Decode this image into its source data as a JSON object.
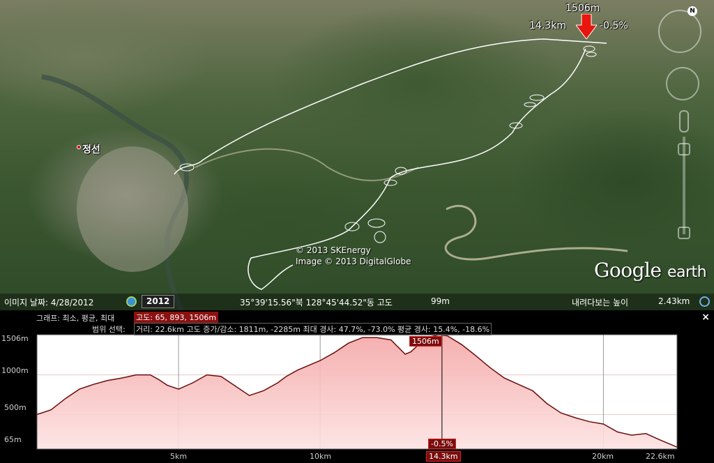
{
  "map": {
    "place_name": "정선",
    "copyright_1": "© 2013 SKEnergy",
    "copyright_2": "Image © 2013 DigitalGlobe",
    "brand_google": "Google",
    "brand_earth": "earth",
    "compass_letter": "N",
    "callout": {
      "elevation": "1506m",
      "distance": "14.3km",
      "slope": "-0.5%"
    }
  },
  "statusbar": {
    "image_date": "이미지 날짜: 4/28/2012",
    "year": "2012",
    "coords": "35°39'15.56\"북 128°45'44.52\"동 고도",
    "altitude": "99m",
    "eye_alt_label": "내려다보는 높이",
    "eye_alt": "2.43km"
  },
  "profile": {
    "graph_label": "그래프: 최소, 평균, 최대",
    "graph_value": "고도: 65, 893, 1506m",
    "stats_label": "범위 선택:",
    "stats_value": "거리: 22.6km 고도 증가/감소: 1811m, -2285m 최대 경사: 47.7%, -73.0% 평균 경사: 15.4%, -18.6%",
    "close": "×",
    "y_ticks": [
      "1506m",
      "1000m",
      "500m",
      "65m"
    ],
    "x_ticks": [
      "5km",
      "10km",
      "20km",
      "22.6km"
    ],
    "cursor_elev": "1506m",
    "cursor_slope": "-0.5%",
    "cursor_dist": "14.3km"
  },
  "chart_data": {
    "type": "area",
    "x_unit": "km",
    "y_unit": "m",
    "xlim": [
      0,
      22.6
    ],
    "ylim": [
      65,
      1506
    ],
    "cursor_x": 14.3,
    "x": [
      0,
      0.5,
      1,
      1.5,
      2,
      2.5,
      3,
      3.5,
      4,
      4.3,
      4.6,
      5,
      5.5,
      6,
      6.5,
      7,
      7.5,
      8,
      8.5,
      8.8,
      9.2,
      9.6,
      10,
      10.5,
      11,
      11.5,
      12,
      12.5,
      13,
      13.2,
      13.5,
      13.8,
      14.2,
      14.5,
      15,
      15.5,
      16,
      16.5,
      17,
      17.5,
      18,
      18.5,
      19,
      19.5,
      20,
      20.5,
      21,
      21.5,
      22,
      22.6
    ],
    "y": [
      500,
      560,
      700,
      820,
      880,
      930,
      960,
      1000,
      1000,
      940,
      870,
      820,
      900,
      1000,
      980,
      860,
      740,
      800,
      900,
      980,
      1060,
      1120,
      1180,
      1280,
      1400,
      1470,
      1470,
      1440,
      1260,
      1290,
      1390,
      1470,
      1506,
      1490,
      1380,
      1240,
      1090,
      960,
      880,
      800,
      640,
      520,
      460,
      410,
      380,
      280,
      240,
      260,
      180,
      90
    ]
  }
}
